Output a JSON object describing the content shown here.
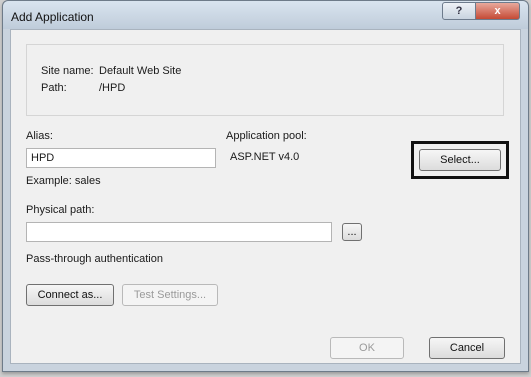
{
  "dialog": {
    "title": "Add Application",
    "help_label": "?",
    "close_label": "x"
  },
  "site_info": {
    "site_name_label": "Site name:",
    "site_name_value": "Default Web Site",
    "path_label": "Path:",
    "path_value": "/HPD"
  },
  "alias": {
    "label": "Alias:",
    "value": "HPD",
    "example": "Example: sales"
  },
  "app_pool": {
    "label": "Application pool:",
    "value": "ASP.NET v4.0",
    "select_label": "Select..."
  },
  "physical_path": {
    "label": "Physical path:",
    "value": "",
    "browse_label": "..."
  },
  "auth": {
    "label": "Pass-through authentication",
    "connect_as_label": "Connect as...",
    "test_settings_label": "Test Settings..."
  },
  "footer": {
    "ok_label": "OK",
    "cancel_label": "Cancel"
  }
}
